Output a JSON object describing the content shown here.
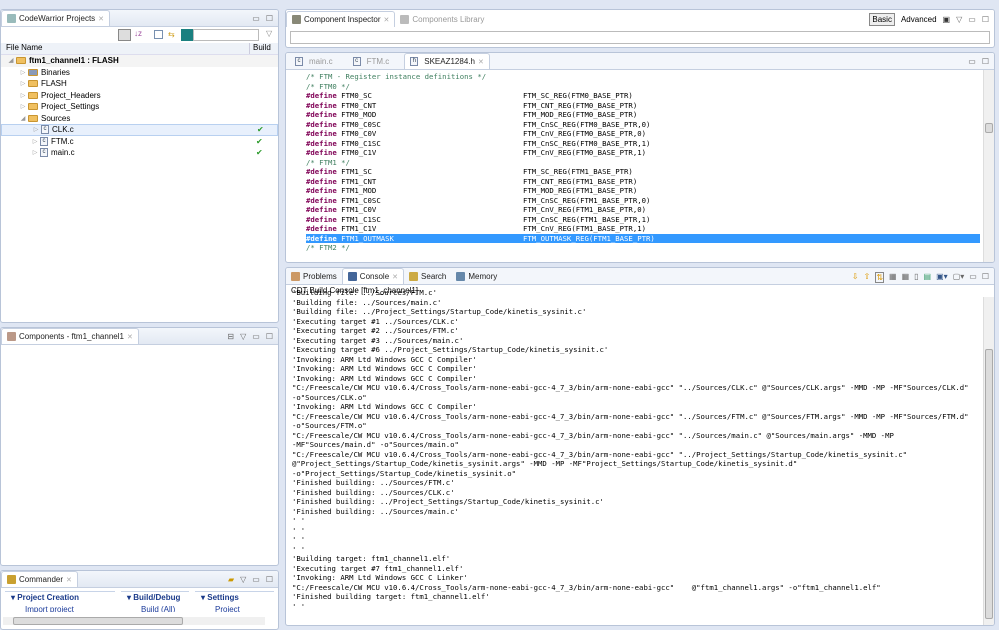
{
  "projects": {
    "title": "CodeWarrior Projects",
    "col_file": "File Name",
    "col_build": "Build",
    "search_value": "",
    "root": "ftm1_channel1  : FLASH",
    "items": [
      {
        "label": "Binaries",
        "type": "binaries",
        "level": 1,
        "expanded": false
      },
      {
        "label": "FLASH",
        "type": "folder",
        "level": 1,
        "expanded": false
      },
      {
        "label": "Project_Headers",
        "type": "folder",
        "level": 1,
        "expanded": false
      },
      {
        "label": "Project_Settings",
        "type": "folder",
        "level": 1,
        "expanded": false
      },
      {
        "label": "Sources",
        "type": "folder",
        "level": 1,
        "expanded": true
      },
      {
        "label": "CLK.c",
        "type": "c",
        "level": 2,
        "built": true,
        "selected": true
      },
      {
        "label": "FTM.c",
        "type": "c",
        "level": 2,
        "built": true
      },
      {
        "label": "main.c",
        "type": "c",
        "level": 2,
        "built": true
      }
    ]
  },
  "components": {
    "title": "Components - ftm1_channel1"
  },
  "commander": {
    "title": "Commander",
    "sections": [
      {
        "title": "Project Creation",
        "item": "Import project"
      },
      {
        "title": "Build/Debug",
        "item": "Build   (All)"
      },
      {
        "title": "Settings",
        "item": "Project settings"
      }
    ]
  },
  "inspector": {
    "tabs": [
      "Component Inspector",
      "Components Library"
    ],
    "basic": "Basic",
    "advanced": "Advanced",
    "filter_value": ""
  },
  "editor": {
    "tabs": [
      "main.c",
      "FTM.c",
      "SKEAZ1284.h"
    ],
    "active_tab": 2,
    "lines": [
      {
        "c": "/* FTM - Register instance definitions */"
      },
      {
        "c": "/* FTM0 */"
      },
      {
        "n": "FTM0_SC",
        "v": "FTM_SC_REG(FTM0_BASE_PTR)"
      },
      {
        "n": "FTM0_CNT",
        "v": "FTM_CNT_REG(FTM0_BASE_PTR)"
      },
      {
        "n": "FTM0_MOD",
        "v": "FTM_MOD_REG(FTM0_BASE_PTR)"
      },
      {
        "n": "FTM0_C0SC",
        "v": "FTM_CnSC_REG(FTM0_BASE_PTR,0)"
      },
      {
        "n": "FTM0_C0V",
        "v": "FTM_CnV_REG(FTM0_BASE_PTR,0)"
      },
      {
        "n": "FTM0_C1SC",
        "v": "FTM_CnSC_REG(FTM0_BASE_PTR,1)"
      },
      {
        "n": "FTM0_C1V",
        "v": "FTM_CnV_REG(FTM0_BASE_PTR,1)"
      },
      {
        "c": "/* FTM1 */"
      },
      {
        "n": "FTM1_SC",
        "v": "FTM_SC_REG(FTM1_BASE_PTR)"
      },
      {
        "n": "FTM1_CNT",
        "v": "FTM_CNT_REG(FTM1_BASE_PTR)"
      },
      {
        "n": "FTM1_MOD",
        "v": "FTM_MOD_REG(FTM1_BASE_PTR)"
      },
      {
        "n": "FTM1_C0SC",
        "v": "FTM_CnSC_REG(FTM1_BASE_PTR,0)"
      },
      {
        "n": "FTM1_C0V",
        "v": "FTM_CnV_REG(FTM1_BASE_PTR,0)"
      },
      {
        "n": "FTM1_C1SC",
        "v": "FTM_CnSC_REG(FTM1_BASE_PTR,1)"
      },
      {
        "n": "FTM1_C1V",
        "v": "FTM_CnV_REG(FTM1_BASE_PTR,1)"
      },
      {
        "n": "FTM1_OUTMASK",
        "v": "FTM_OUTMASK_REG(FTM1_BASE_PTR)",
        "selected": true
      },
      {
        "c": "/* FTM2 */"
      }
    ],
    "keyword": "#define"
  },
  "console": {
    "tabs": [
      "Problems",
      "Console",
      "Search",
      "Memory"
    ],
    "active_tab": 1,
    "title": "CDT Build Console [ftm1_channel1]",
    "lines": [
      "'Building file: ../Sources/FTM.c'",
      "'Building file: ../Sources/main.c'",
      "'Building file: ../Project_Settings/Startup_Code/kinetis_sysinit.c'",
      "'Executing target #1 ../Sources/CLK.c'",
      "'Executing target #2 ../Sources/FTM.c'",
      "'Executing target #3 ../Sources/main.c'",
      "'Executing target #6 ../Project_Settings/Startup_Code/kinetis_sysinit.c'",
      "'Invoking: ARM Ltd Windows GCC C Compiler'",
      "'Invoking: ARM Ltd Windows GCC C Compiler'",
      "'Invoking: ARM Ltd Windows GCC C Compiler'",
      "\"C:/Freescale/CW MCU v10.6.4/Cross_Tools/arm-none-eabi-gcc-4_7_3/bin/arm-none-eabi-gcc\" \"../Sources/CLK.c\" @\"Sources/CLK.args\" -MMD -MP -MF\"Sources/CLK.d\"",
      "-o\"Sources/CLK.o\"",
      "'Invoking: ARM Ltd Windows GCC C Compiler'",
      "\"C:/Freescale/CW MCU v10.6.4/Cross_Tools/arm-none-eabi-gcc-4_7_3/bin/arm-none-eabi-gcc\" \"../Sources/FTM.c\" @\"Sources/FTM.args\" -MMD -MP -MF\"Sources/FTM.d\"",
      "-o\"Sources/FTM.o\"",
      "\"C:/Freescale/CW MCU v10.6.4/Cross_Tools/arm-none-eabi-gcc-4_7_3/bin/arm-none-eabi-gcc\" \"../Sources/main.c\" @\"Sources/main.args\" -MMD -MP",
      "-MF\"Sources/main.d\" -o\"Sources/main.o\"",
      "\"C:/Freescale/CW MCU v10.6.4/Cross_Tools/arm-none-eabi-gcc-4_7_3/bin/arm-none-eabi-gcc\" \"../Project_Settings/Startup_Code/kinetis_sysinit.c\"",
      "@\"Project_Settings/Startup_Code/kinetis_sysinit.args\" -MMD -MP -MF\"Project_Settings/Startup_Code/kinetis_sysinit.d\"",
      "-o\"Project_Settings/Startup_Code/kinetis_sysinit.o\"",
      "'Finished building: ../Sources/FTM.c'",
      "'Finished building: ../Sources/CLK.c'",
      "'Finished building: ../Project_Settings/Startup_Code/kinetis_sysinit.c'",
      "'Finished building: ../Sources/main.c'",
      "' '",
      "' '",
      "' '",
      "' '",
      "'Building target: ftm1_channel1.elf'",
      "'Executing target #7 ftm1_channel1.elf'",
      "'Invoking: ARM Ltd Windows GCC C Linker'",
      "\"C:/Freescale/CW MCU v10.6.4/Cross_Tools/arm-none-eabi-gcc-4_7_3/bin/arm-none-eabi-gcc\"    @\"ftm1_channel1.args\" -o\"ftm1_channel1.elf\"",
      "'Finished building target: ftm1_channel1.elf'",
      "' '"
    ]
  }
}
